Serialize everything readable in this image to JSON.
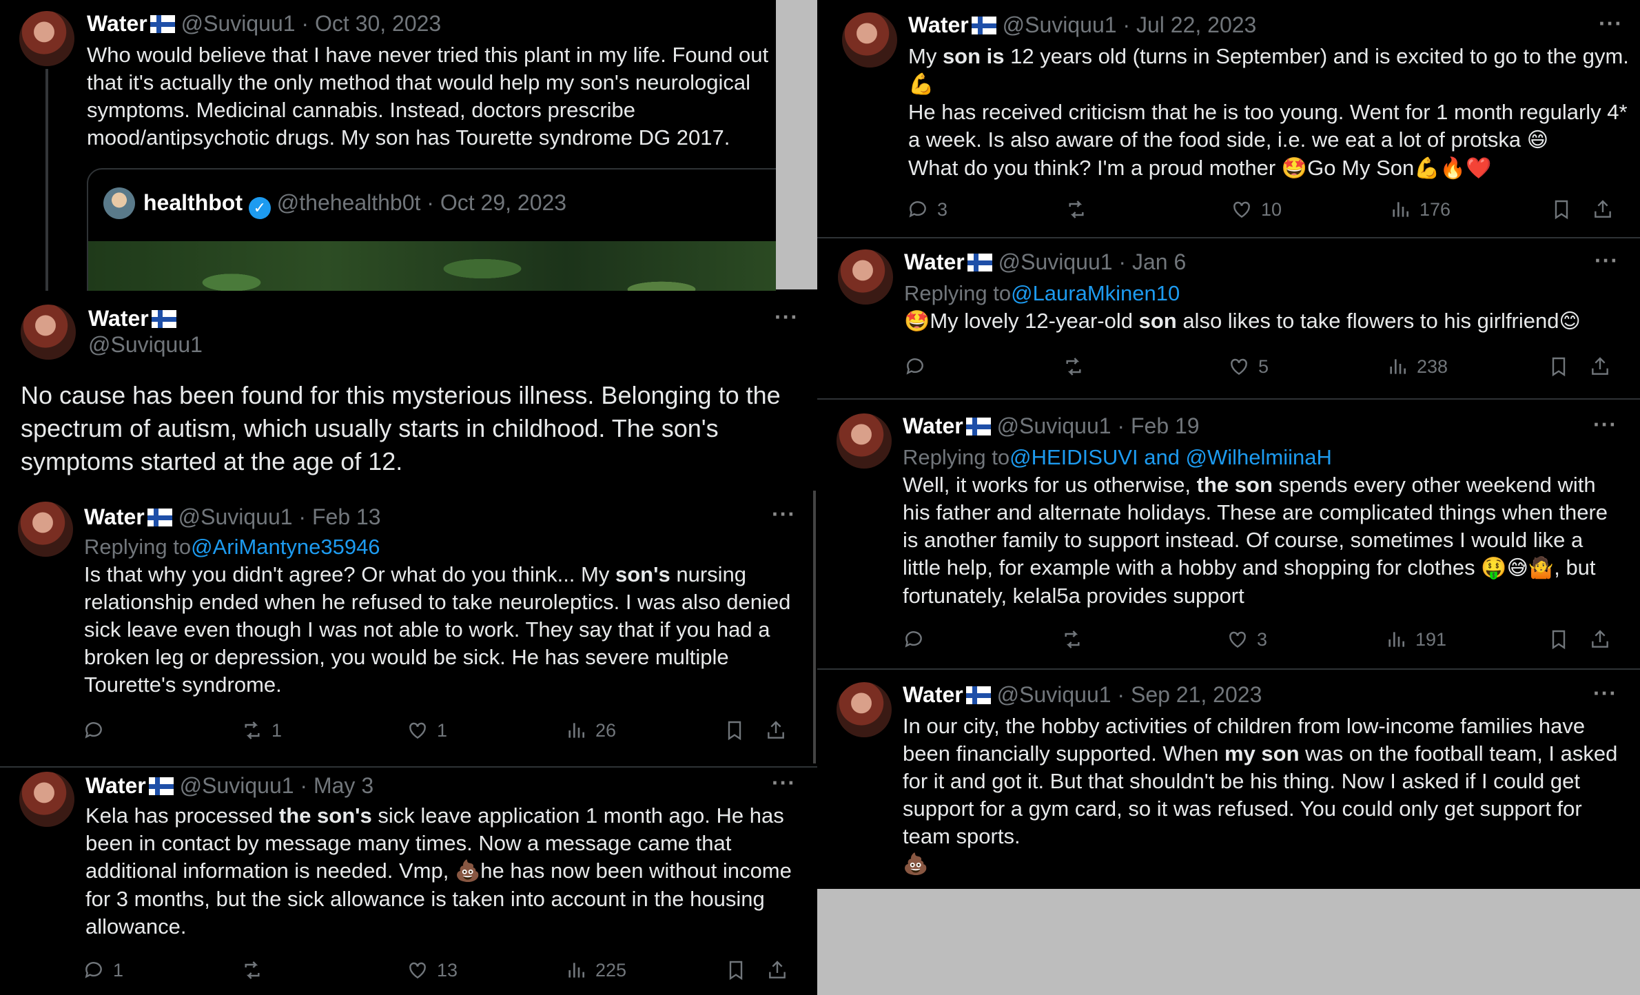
{
  "panel_a": {
    "name": "Water",
    "handle": "@Suviquu1",
    "date": "· Oct 30, 2023",
    "text": "Who would believe that I have never tried this plant in my life. Found out that it's actually the only method that would help my son's neurological symptoms. Medicinal cannabis. Instead, doctors prescribe mood/antipsychotic drugs. My son has Tourette syndrome DG 2017.",
    "quote": {
      "name": "healthbot",
      "handle": "@thehealthb0t",
      "date": "· Oct 29, 2023"
    }
  },
  "panel_b": {
    "name": "Water",
    "handle": "@Suviquu1",
    "more": "···",
    "text": "No cause has been found for this mysterious illness. Belonging to the spectrum of autism, which usually starts in childhood. The son's symptoms started at the age of 12."
  },
  "tweets": [
    {
      "name": "Water",
      "handle": "@Suviquu1",
      "date": "· Feb 13",
      "more": "···",
      "reply_prefix": "Replying to",
      "reply_to": "@AriMantyne35946",
      "text_parts": [
        "Is that why you didn't agree? Or what do you think... My ",
        "son's",
        " nursing relationship ended when he refused to take neuroleptics. I was also denied sick leave even though I was not able to work. They say that if you had a broken leg or depression, you would be sick. He has severe multiple Tourette's syndrome."
      ],
      "replies": "",
      "retweets": "1",
      "likes": "1",
      "views": "26"
    },
    {
      "name": "Water",
      "handle": "@Suviquu1",
      "date": "· May 3",
      "more": "···",
      "text_parts": [
        "Kela has processed ",
        "the son's",
        " sick leave application 1 month ago. He has been in contact by message many times. Now a message came that additional information is needed. Vmp, ",
        "💩",
        "he has now been without income for 3 months, but the sick allowance is taken into account in the housing allowance."
      ],
      "replies": "1",
      "retweets": "",
      "likes": "13",
      "views": "225"
    },
    {
      "name": "Water",
      "handle": "@Suviquu1",
      "date": "· Jul 22, 2023",
      "more": "···",
      "text_parts": [
        "My ",
        "son is",
        " 12 years old (turns in September) and is excited to go to the gym. ",
        "💪",
        "He has received criticism that he is too young. Went for 1 month regularly 4* a week. Is also aware of the food side, i.e. we eat a lot of protska ",
        "😄",
        "What do you think? I'm a proud mother ",
        "🤩",
        "Go My Son",
        "💪🔥❤️"
      ],
      "replies": "3",
      "retweets": "",
      "likes": "10",
      "views": "176"
    },
    {
      "name": "Water",
      "handle": "@Suviquu1",
      "date": "· Jan 6",
      "more": "···",
      "reply_prefix": "Replying to",
      "reply_to": "@LauraMkinen10",
      "text_parts": [
        "🤩",
        "My lovely 12-year-old ",
        "son",
        " also likes to take flowers to his girlfriend",
        "😊"
      ],
      "replies": "",
      "retweets": "",
      "likes": "5",
      "views": "238"
    },
    {
      "name": "Water",
      "handle": "@Suviquu1",
      "date": "· Feb 19",
      "more": "···",
      "reply_prefix": "Replying to",
      "reply_to": "@HEIDISUVI and @WilhelmiinaH",
      "text_parts": [
        "Well, it works for us otherwise, ",
        "the son",
        " spends every other weekend with his father and alternate holidays. These are complicated things when there is another family to support instead. Of course, sometimes I would like a little help, for example with a hobby and shopping for clothes ",
        "🤑😅🤷",
        ", but fortunately, kelal5a provides support"
      ],
      "replies": "",
      "retweets": "",
      "likes": "3",
      "views": "191"
    },
    {
      "name": "Water",
      "handle": "@Suviquu1",
      "date": "· Sep 21, 2023",
      "more": "···",
      "text_parts": [
        "In our city, the hobby activities of children from low-income families have been financially supported. When ",
        "my son",
        " was on the football team, I asked for it and got it. But that shouldn't be his thing. Now I asked if I could get support for a gym card, so it was refused. You could only get support for team sports.",
        "💩"
      ]
    }
  ]
}
